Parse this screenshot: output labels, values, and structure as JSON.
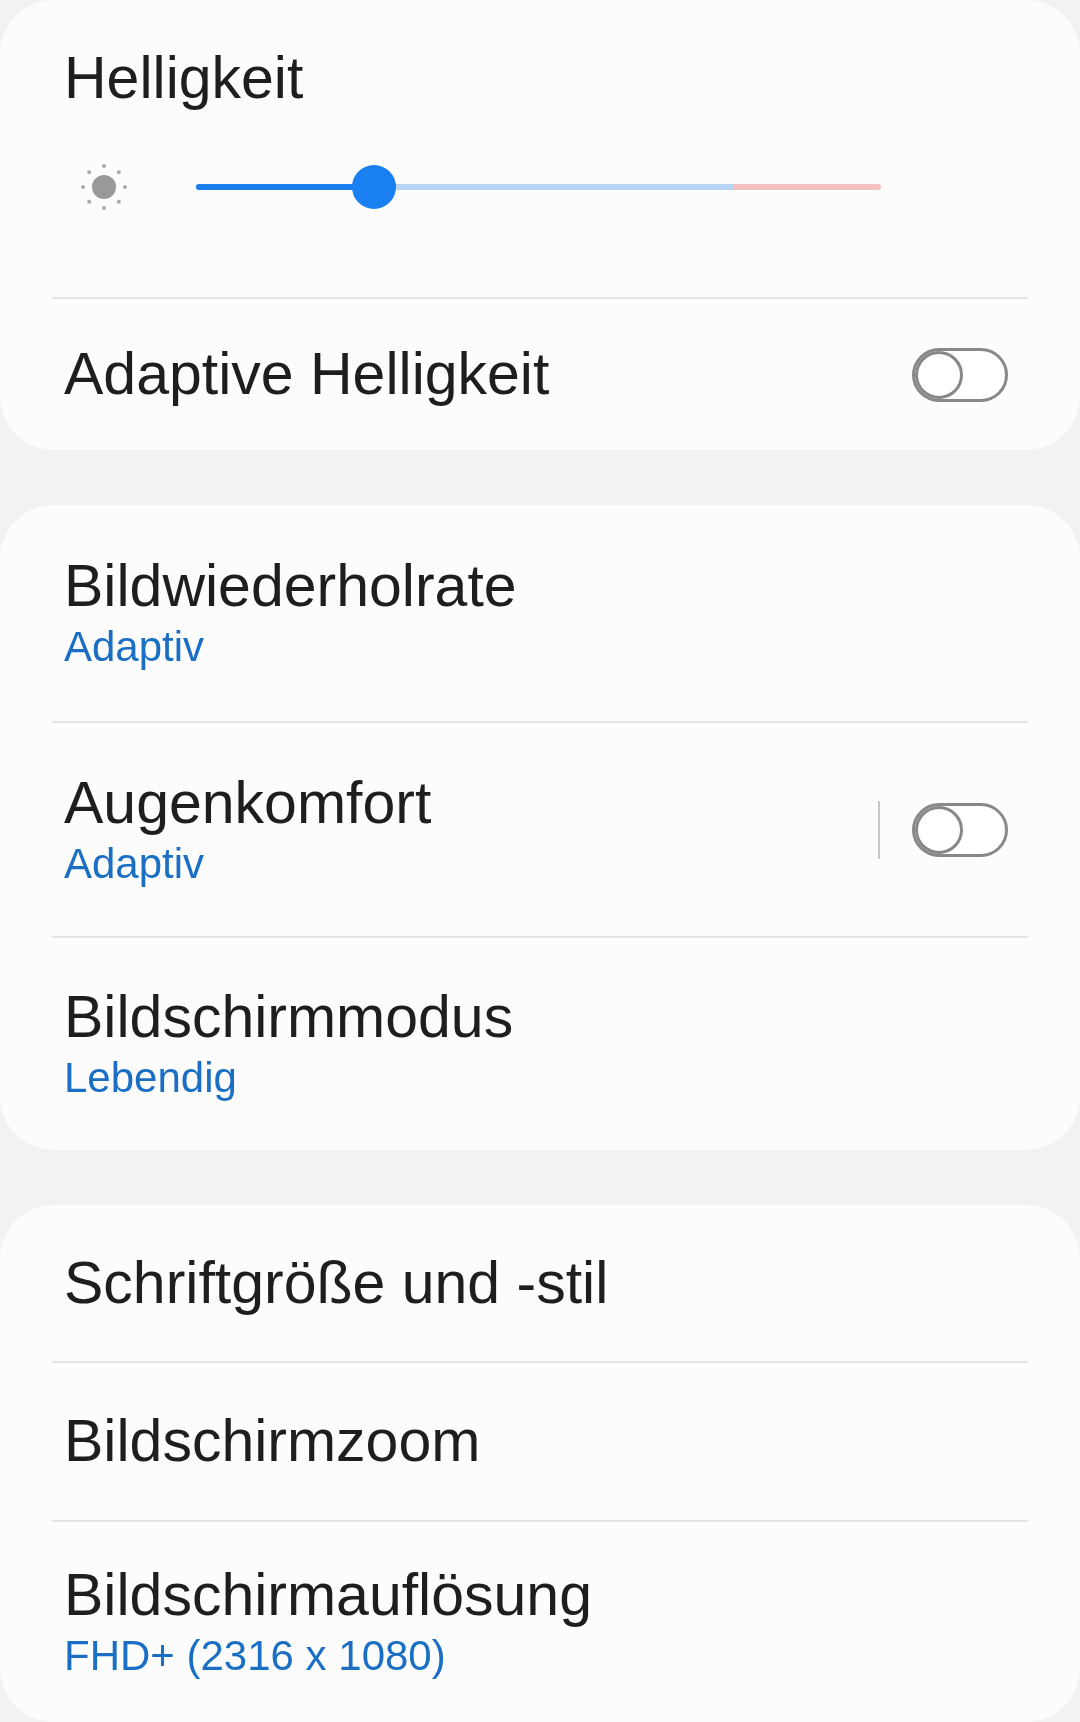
{
  "brightness": {
    "title": "Helligkeit",
    "level": 0.26,
    "adaptive": {
      "label": "Adaptive Helligkeit",
      "on": false
    }
  },
  "groups": [
    {
      "items": [
        {
          "title": "Bildwiederholrate",
          "value": "Adaptiv"
        },
        {
          "title": "Augenkomfort",
          "value": "Adaptiv",
          "toggle": {
            "on": false
          }
        },
        {
          "title": "Bildschirmmodus",
          "value": "Lebendig"
        }
      ]
    },
    {
      "items": [
        {
          "title": "Schriftgröße und -stil"
        },
        {
          "title": "Bildschirmzoom"
        },
        {
          "title": "Bildschirmauflösung",
          "value": "FHD+ (2316 x 1080)"
        }
      ]
    }
  ]
}
